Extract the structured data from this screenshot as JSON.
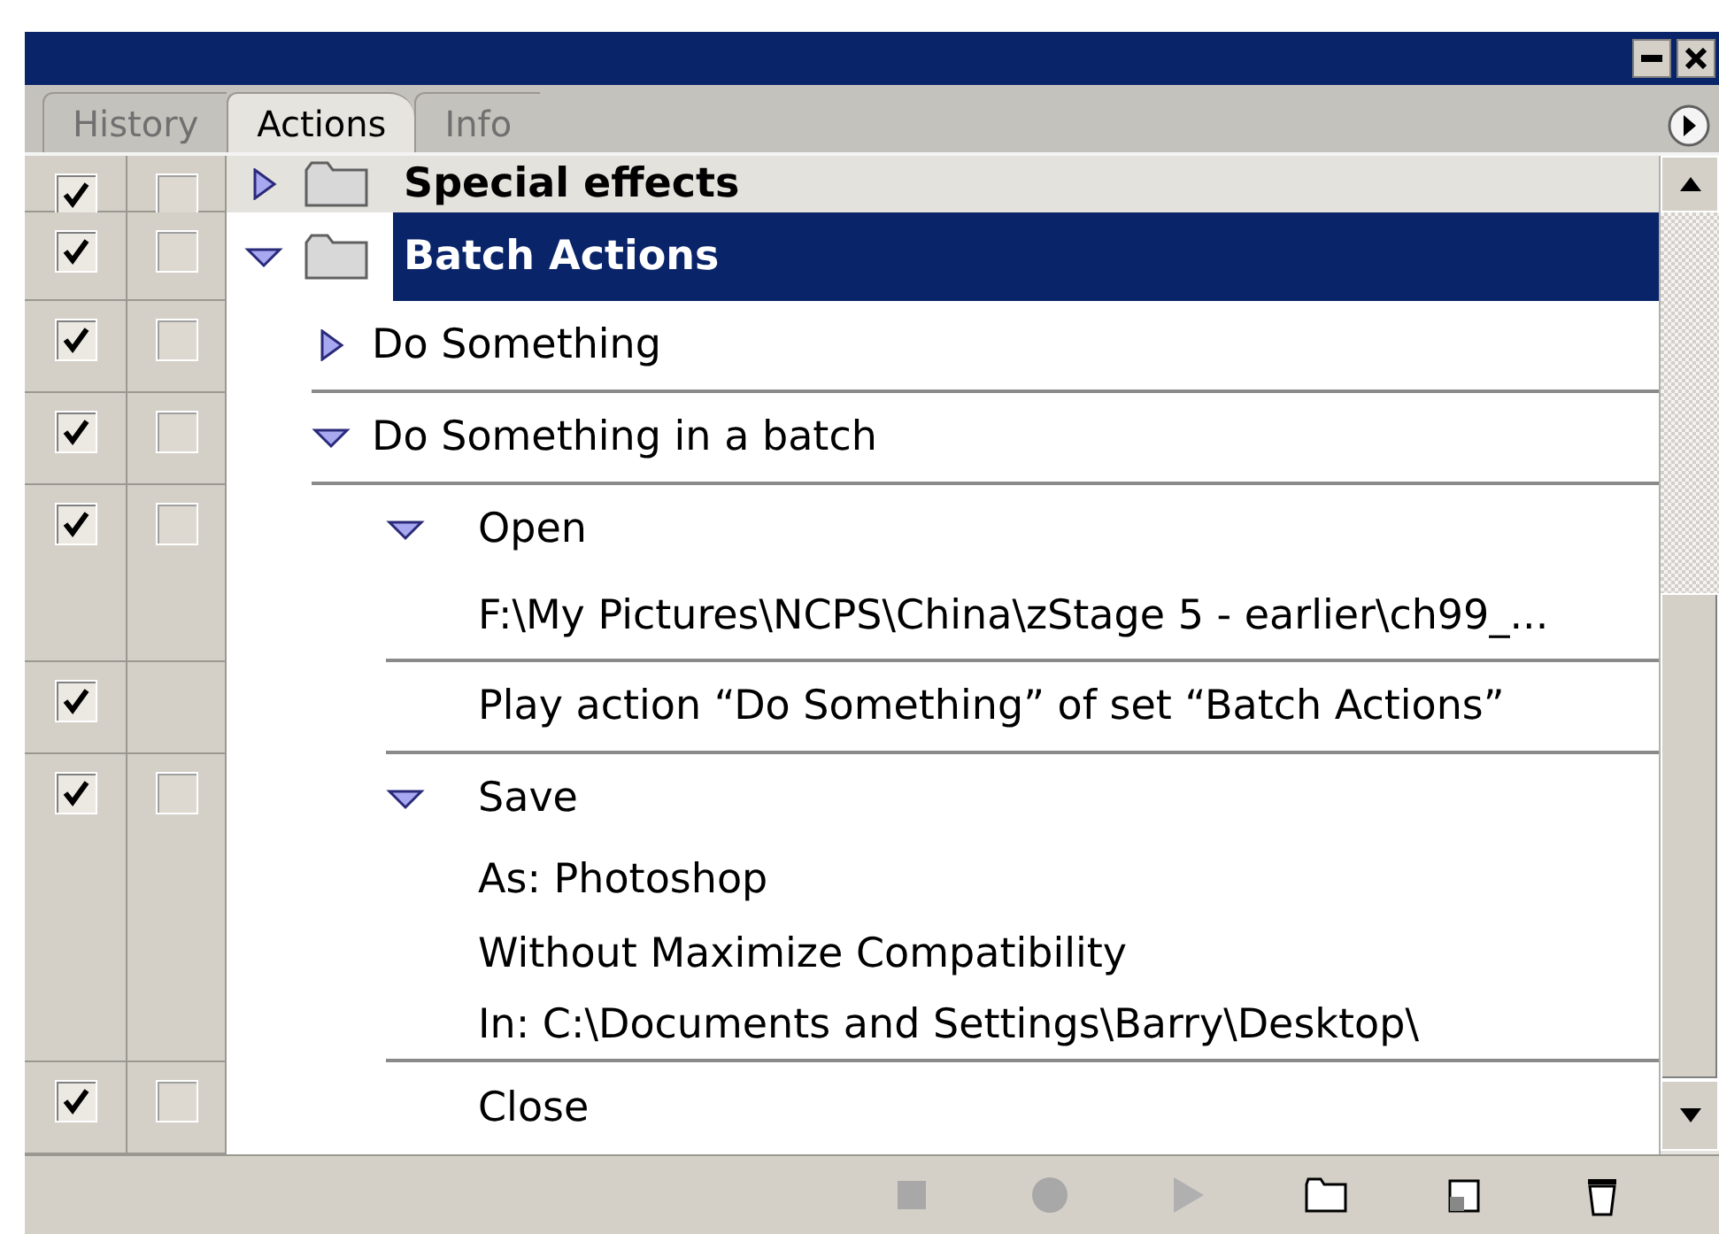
{
  "tabs": [
    {
      "label": "History",
      "selected": false
    },
    {
      "label": "Actions",
      "selected": true
    },
    {
      "label": "Info",
      "selected": false
    }
  ],
  "action_sets": [
    {
      "name": "Special effects",
      "enabled": true,
      "dialog_toggle": true,
      "expanded": false,
      "selected": false
    },
    {
      "name": "Batch Actions",
      "enabled": true,
      "dialog_toggle": true,
      "expanded": true,
      "selected": true,
      "children": [
        {
          "name": "Do Something",
          "enabled": true,
          "dialog_toggle": true,
          "expanded": false
        },
        {
          "name": "Do Something in a batch",
          "enabled": true,
          "dialog_toggle": true,
          "expanded": true,
          "children": [
            {
              "name": "Open",
              "enabled": true,
              "dialog_toggle": true,
              "expanded": true,
              "details": [
                "F:\\My Pictures\\NCPS\\China\\zStage 5 - earlier\\ch99_..."
              ]
            },
            {
              "name": "Play action “Do Something” of set “Batch Actions”",
              "enabled": true,
              "dialog_toggle": false
            },
            {
              "name": "Save",
              "enabled": true,
              "dialog_toggle": true,
              "expanded": true,
              "details": [
                "As: Photoshop",
                "Without Maximize Compatibility",
                "In: C:\\Documents and Settings\\Barry\\Desktop\\"
              ]
            },
            {
              "name": "Close",
              "enabled": true,
              "dialog_toggle": true
            }
          ]
        }
      ]
    }
  ]
}
